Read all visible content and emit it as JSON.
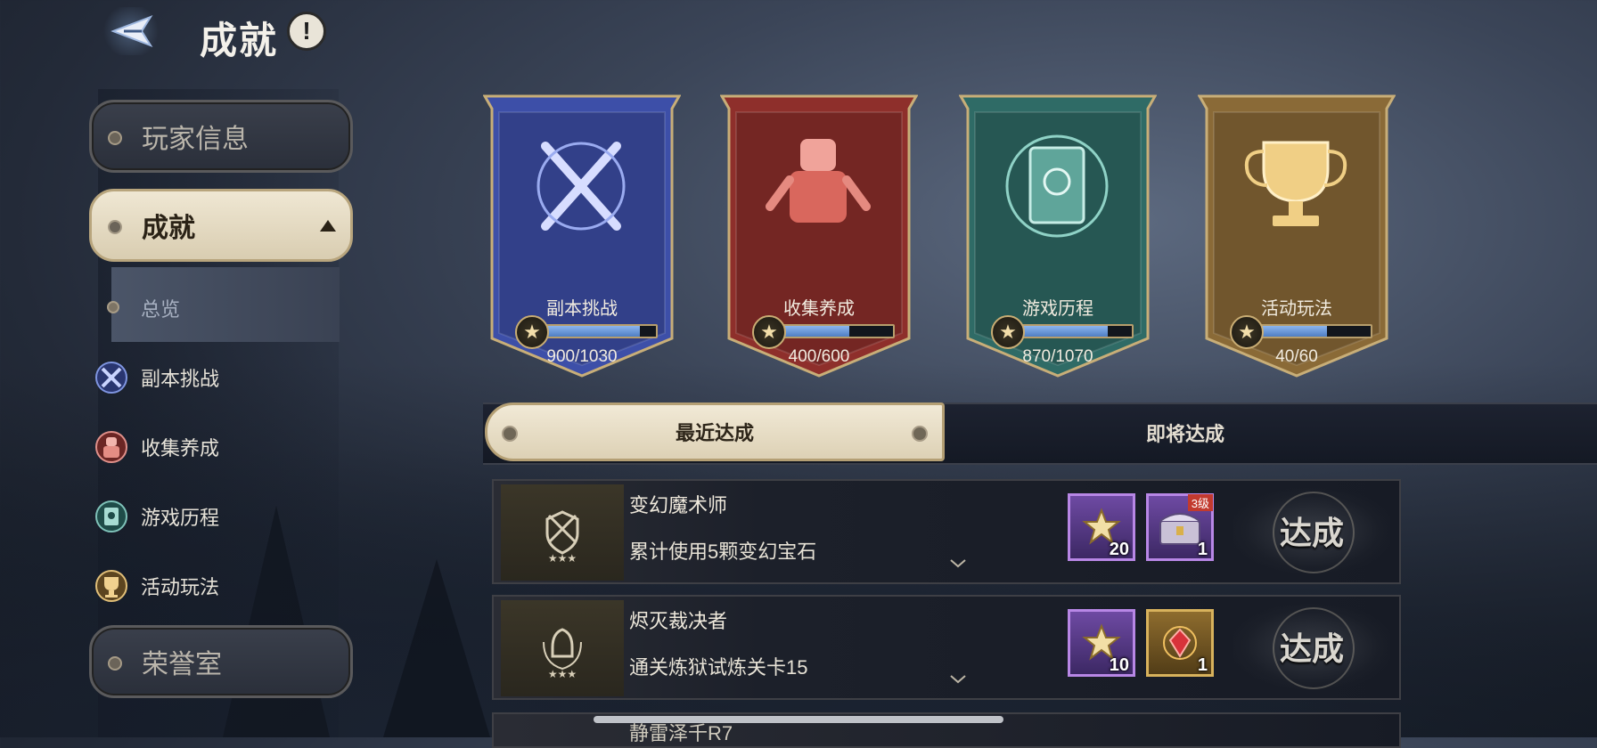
{
  "header": {
    "title": "成就",
    "info_glyph": "!"
  },
  "sidebar": {
    "player_info": "玩家信息",
    "achievements": "成就",
    "sub_items": [
      {
        "label": "总览",
        "icon": "dot-icon"
      },
      {
        "label": "副本挑战",
        "icon": "crossed-swords-icon"
      },
      {
        "label": "收集养成",
        "icon": "armor-icon"
      },
      {
        "label": "游戏历程",
        "icon": "book-icon"
      },
      {
        "label": "活动玩法",
        "icon": "trophy-icon"
      }
    ],
    "honor_hall": "荣誉室"
  },
  "categories": [
    {
      "label": "副本挑战",
      "current": 900,
      "total": 1030,
      "count_text": "900/1030",
      "fraction": 0.874,
      "color": "#3d4fa8",
      "icon": "crossed-swords-icon"
    },
    {
      "label": "收集养成",
      "current": 400,
      "total": 600,
      "count_text": "400/600",
      "fraction": 0.667,
      "color": "#8e2f2b",
      "icon": "armor-icon"
    },
    {
      "label": "游戏历程",
      "current": 870,
      "total": 1070,
      "count_text": "870/1070",
      "fraction": 0.813,
      "color": "#2f6b66",
      "icon": "book-icon"
    },
    {
      "label": "活动玩法",
      "current": 40,
      "total": 60,
      "count_text": "40/60",
      "fraction": 0.667,
      "color": "#8a6a37",
      "icon": "trophy-icon"
    }
  ],
  "tabs": {
    "recent": "最近达成",
    "upcoming": "即将达成"
  },
  "achievements": [
    {
      "name": "变幻魔术师",
      "description": "累计使用5颗变幻宝石",
      "rewards": [
        {
          "icon": "achievement-star-icon",
          "qty": "20",
          "rarity": "purple"
        },
        {
          "icon": "treasure-chest-icon",
          "qty": "1",
          "rarity": "purple",
          "tag": "3级"
        }
      ],
      "button": "达成"
    },
    {
      "name": "烬灭裁决者",
      "description": "通关炼狱试炼关卡15",
      "rewards": [
        {
          "icon": "achievement-star-icon",
          "qty": "10",
          "rarity": "purple"
        },
        {
          "icon": "red-gem-icon",
          "qty": "1",
          "rarity": "gold"
        }
      ],
      "button": "达成"
    }
  ],
  "partial_row": {
    "name": "静雷泽千R7"
  }
}
